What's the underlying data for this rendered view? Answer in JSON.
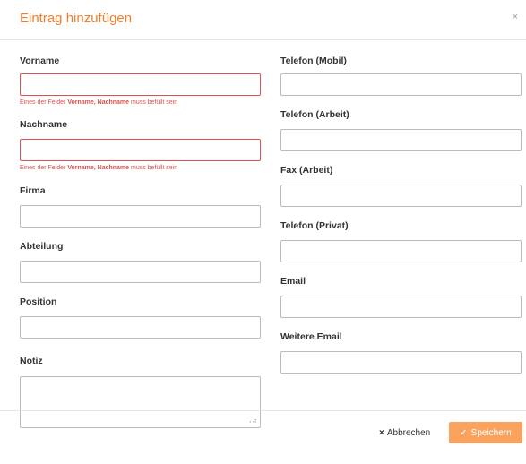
{
  "dialog": {
    "title": "Eintrag hinzufügen",
    "close_glyph": "×"
  },
  "left_fields": [
    {
      "label": "Vorname",
      "value": "",
      "error": true,
      "error_prefix": "Eines der Felder ",
      "error_bold": "Vorname, Nachname",
      "error_suffix": " muss befüllt sein"
    },
    {
      "label": "Nachname",
      "value": "",
      "error": true,
      "error_prefix": "Eines der Felder ",
      "error_bold": "Vorname, Nachname",
      "error_suffix": " muss befüllt sein"
    },
    {
      "label": "Firma",
      "value": ""
    },
    {
      "label": "Abteilung",
      "value": ""
    },
    {
      "label": "Position",
      "value": ""
    },
    {
      "label": "Notiz",
      "value": ""
    }
  ],
  "right_fields": [
    {
      "label": "Telefon (Mobil)",
      "value": ""
    },
    {
      "label": "Telefon (Arbeit)",
      "value": ""
    },
    {
      "label": "Fax (Arbeit)",
      "value": ""
    },
    {
      "label": "Telefon (Privat)",
      "value": ""
    },
    {
      "label": "Email",
      "value": ""
    },
    {
      "label": "Weitere Email",
      "value": ""
    }
  ],
  "footer": {
    "cancel_glyph": "×",
    "cancel_label": "Abbrechen",
    "save_glyph": "✓",
    "save_label": "Speichern"
  },
  "colors": {
    "accent": "#f07f2c",
    "save_button": "#f9a35f",
    "error": "#d9534f"
  }
}
